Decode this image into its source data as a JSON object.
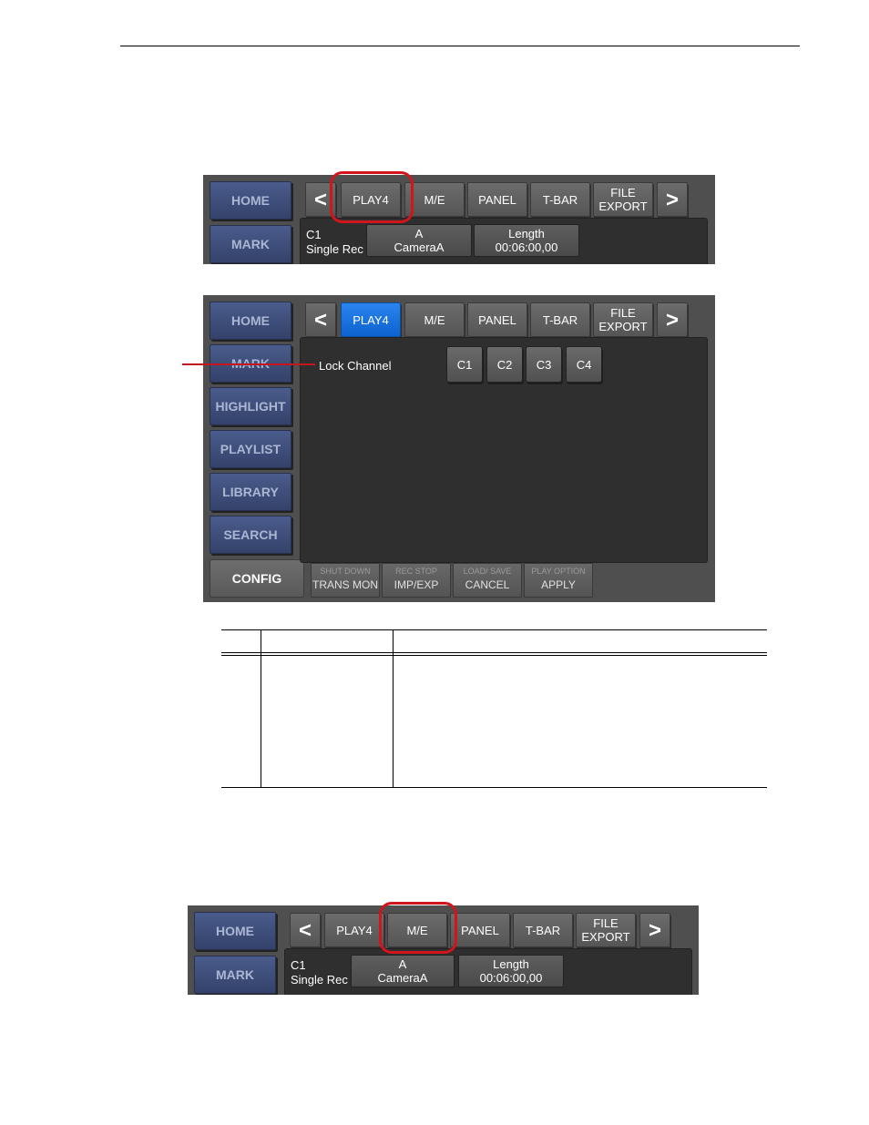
{
  "colors": {
    "selected_tab": "#1a73e0",
    "highlight_circle": "#d0151c",
    "side_button": "#3e4d78"
  },
  "nav": {
    "prev": "<",
    "next": ">",
    "tabs": [
      "PLAY4",
      "M/E",
      "PANEL",
      "T-BAR",
      "FILE\nEXPORT"
    ]
  },
  "side_buttons": [
    "HOME",
    "MARK",
    "HIGHLIGHT",
    "PLAYLIST",
    "LIBRARY",
    "SEARCH",
    "CONFIG"
  ],
  "info": {
    "channel": "C1",
    "mode": "Single Rec",
    "camera_top": "A",
    "camera_bottom": "CameraA",
    "length_label": "Length",
    "length_value": "00:06:00,00"
  },
  "lock": {
    "label": "Lock Channel",
    "channels": [
      "C1",
      "C2",
      "C3",
      "C4"
    ]
  },
  "function_keys": [
    {
      "small": "SHUT DOWN",
      "large": "TRANS MON"
    },
    {
      "small": "REC STOP",
      "large": "IMP/EXP"
    },
    {
      "small": "LOAD/ SAVE",
      "large": "CANCEL"
    },
    {
      "small": "PLAY OPTION",
      "large": "APPLY"
    }
  ]
}
